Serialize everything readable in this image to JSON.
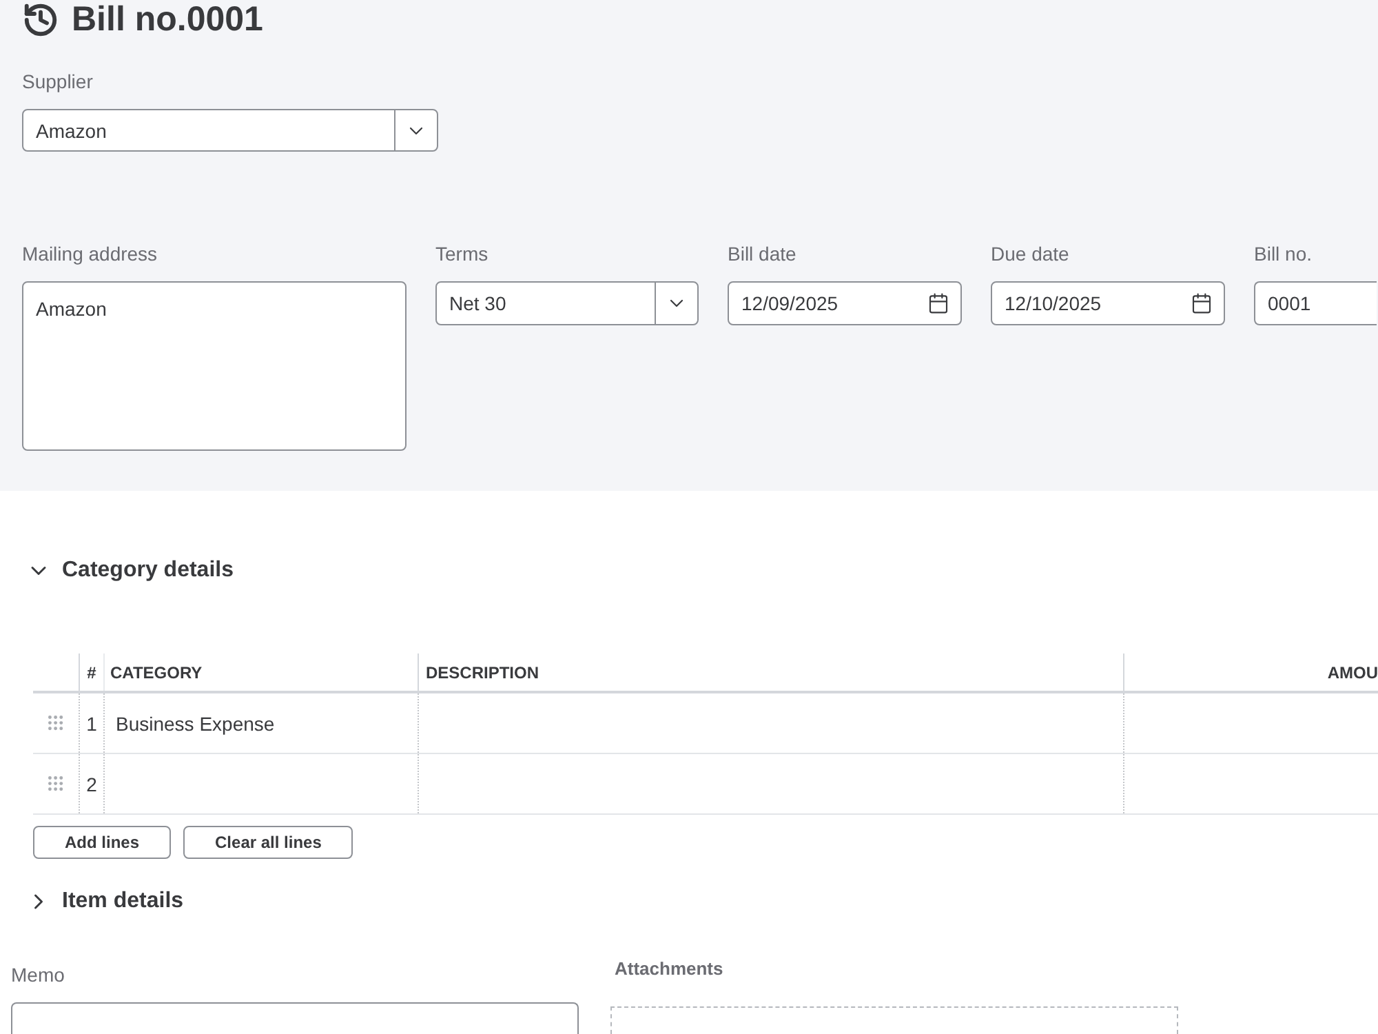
{
  "title": "Bill no.0001",
  "supplier": {
    "label": "Supplier",
    "value": "Amazon"
  },
  "fields": [
    {
      "kind": "address",
      "label": "Mailing address",
      "value": "Amazon"
    },
    {
      "kind": "select",
      "label": "Terms",
      "value": "Net 30"
    },
    {
      "kind": "date",
      "label": "Bill date",
      "value": "12/09/2025"
    },
    {
      "kind": "date",
      "label": "Due date",
      "value": "12/10/2025"
    },
    {
      "kind": "text",
      "label": "Bill no.",
      "value": "0001"
    }
  ],
  "category_details": {
    "title": "Category details",
    "expanded": true,
    "table": {
      "columns": [
        "#",
        "CATEGORY",
        "DESCRIPTION",
        "AMOU"
      ],
      "rows": [
        {
          "number": "1",
          "category": "Business Expense"
        },
        {
          "number": "2"
        }
      ]
    },
    "buttons": [
      "Add lines",
      "Clear all lines"
    ]
  },
  "item_details": {
    "title": "Item details",
    "expanded": false
  },
  "memo": {
    "label": "Memo"
  },
  "attachments": {
    "label": "Attachments"
  }
}
